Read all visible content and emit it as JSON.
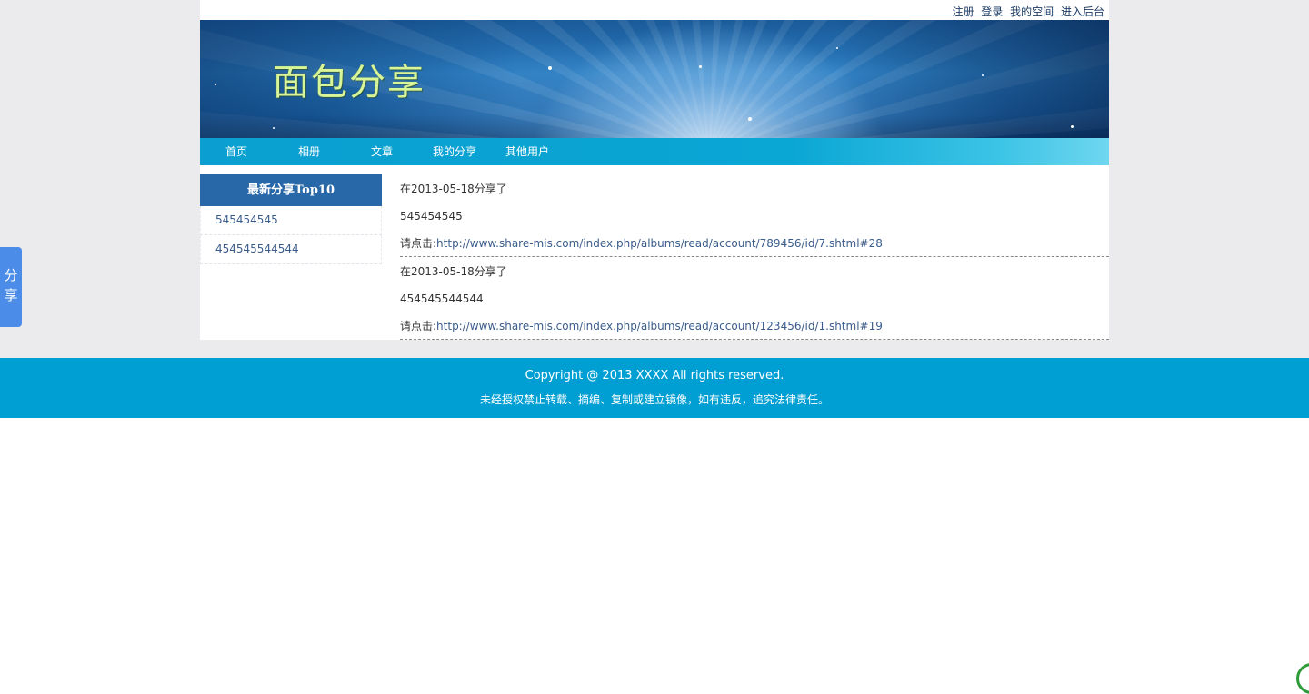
{
  "top_links": [
    "注册",
    "登录",
    "我的空间",
    "进入后台"
  ],
  "logo_text": "面包分享",
  "nav": [
    "首页",
    "相册",
    "文章",
    "我的分享",
    "其他用户"
  ],
  "sidebar": {
    "title": "最新分享Top10",
    "items": [
      "545454545",
      "454545544544"
    ]
  },
  "entries": [
    {
      "date_line": "在2013-05-18分享了",
      "value": "545454545",
      "link_prefix": "请点击:",
      "link": "http://www.share-mis.com/index.php/albums/read/account/789456/id/7.shtml#28"
    },
    {
      "date_line": "在2013-05-18分享了",
      "value": "454545544544",
      "link_prefix": "请点击:",
      "link": "http://www.share-mis.com/index.php/albums/read/account/123456/id/1.shtml#19"
    }
  ],
  "footer": {
    "copyright": "Copyright @ 2013 XXXX All rights reserved.",
    "notice": "未经授权禁止转载、摘编、复制或建立镜像，如有违反，追究法律责任。"
  },
  "share_tab": [
    "分",
    "享"
  ],
  "colors": {
    "nav_bg": "#0aa6d4",
    "sidebar_header": "#2868a8",
    "footer_bg": "#009fd3",
    "link": "#3a5c8c",
    "logo": "#d8f59a"
  }
}
